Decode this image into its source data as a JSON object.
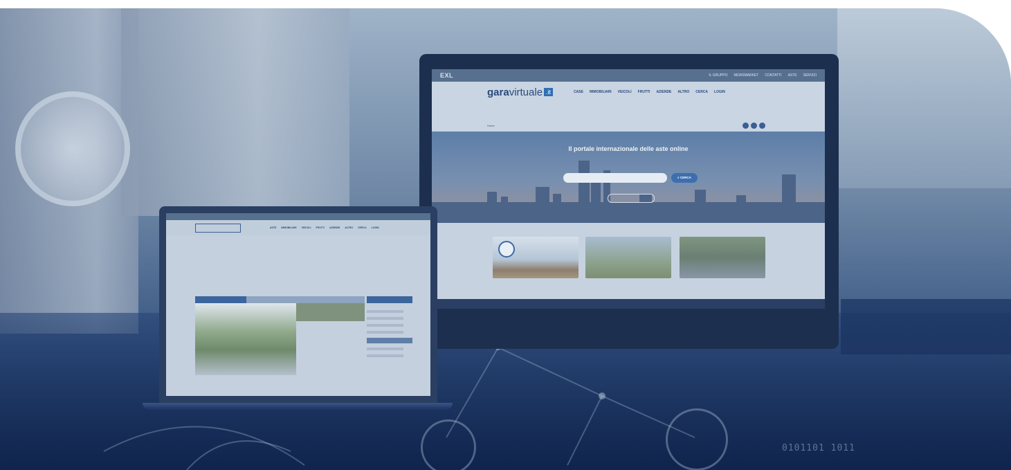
{
  "desktop_site": {
    "topbar": {
      "logo": "EXL",
      "links": [
        "IL GRUPPO",
        "NEWSMARKET",
        "CONTATTI",
        "ASTE",
        "SERVIZI"
      ]
    },
    "header": {
      "logo_bold": "gara",
      "logo_regular": "virtuale",
      "logo_tld": ".it",
      "nav": [
        "CASE",
        "IMMOBILIARI",
        "VEICOLI",
        "FRUTTI",
        "AZIENDE",
        "ALTRO",
        "CERCA",
        "LOGIN"
      ]
    },
    "notice": {
      "line1": "",
      "line2": "",
      "home_link": "Home"
    },
    "hero": {
      "title": "Il portale internazionale delle aste online",
      "search_placeholder": "",
      "search_filter": "",
      "search_button": "CERCA",
      "advanced_button": ""
    },
    "cards": {
      "card1_text": ""
    }
  },
  "laptop_site": {
    "nav": [
      "ASTE",
      "IMMOBILIARI",
      "VEICOLI",
      "FRUTTI",
      "AZIENDE",
      "ALTRO",
      "CERCA",
      "LOGIN"
    ],
    "listing_title": "",
    "listing_subtitle": "",
    "price_label": "",
    "price": ""
  },
  "decor": {
    "binary_bottom": "0101101 1011",
    "binary_top": ""
  }
}
